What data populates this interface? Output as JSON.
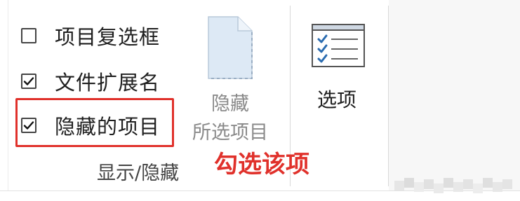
{
  "show_hide_group": {
    "label": "显示/隐藏",
    "checkboxes": [
      {
        "label": "项目复选框",
        "checked": false
      },
      {
        "label": "文件扩展名",
        "checked": true
      },
      {
        "label": "隐藏的项目",
        "checked": true
      }
    ]
  },
  "hide_selected_button": {
    "label_line1": "隐藏",
    "label_line2": "所选项目",
    "icon": "document-hidden-icon",
    "enabled": false
  },
  "options_button": {
    "label": "选项",
    "icon": "options-checklist-icon"
  },
  "annotation": {
    "text": "勾选该项",
    "color": "#e0312b"
  },
  "colors": {
    "accent_red": "#e0312b",
    "icon_blue": "#2b6cb0"
  }
}
